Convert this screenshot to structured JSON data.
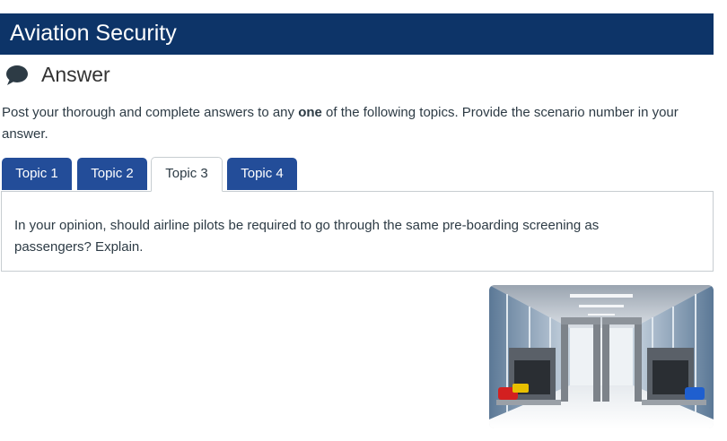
{
  "banner": {
    "title": "Aviation Security",
    "bg_color": "#0d3468"
  },
  "section": {
    "icon": "speech-bubble-icon",
    "title": "Answer"
  },
  "intro": {
    "text_before": "Post your thorough and complete answers to any ",
    "bold": "one",
    "text_after": " of the following topics. Provide the scenario number in your answer."
  },
  "tabs": [
    {
      "label": "Topic 1",
      "active": false
    },
    {
      "label": "Topic 2",
      "active": false
    },
    {
      "label": "Topic 3",
      "active": true
    },
    {
      "label": "Topic 4",
      "active": false
    }
  ],
  "tab_colors": {
    "inactive_bg": "#234d99",
    "inactive_text": "#ffffff"
  },
  "panel": {
    "text": "In your opinion, should airline pilots be required to go through the same pre-boarding screening as passengers? Explain."
  },
  "image": {
    "subject": "airport-security-checkpoint-image"
  }
}
